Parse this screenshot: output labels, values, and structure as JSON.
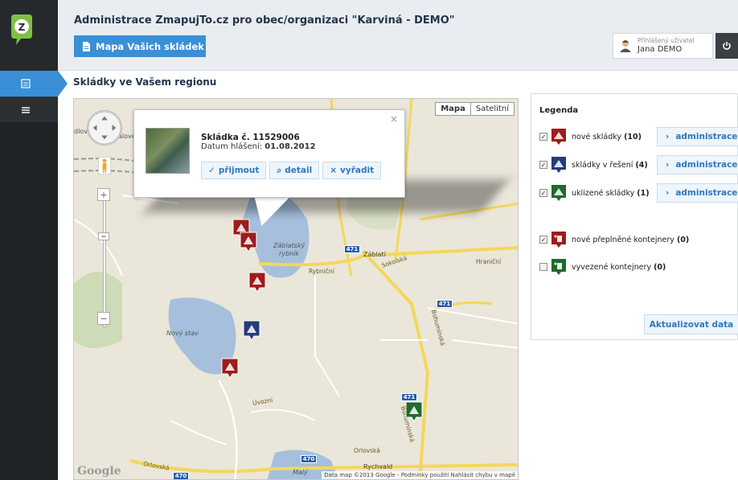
{
  "app": {
    "title": "Administrace ZmapujTo.cz pro obec/organizaci \"Karviná - DEMO\"",
    "tab_label": "Mapa Vašich skládek",
    "user_label": "Přihlášený uživatel",
    "user_name": "Jana DEMO"
  },
  "page": {
    "title": "Skládky ve Vašem regionu"
  },
  "map": {
    "type_map": "Mapa",
    "type_sat": "Satelitní",
    "labels": {
      "zablatsky": "Záblatský",
      "rybnik": "rybník",
      "zablati": "Záblatí",
      "novy_stav": "Nový stav",
      "rychvald": "Rychvald",
      "orlovska": "Orlovská",
      "orlovska2": "Orlovská",
      "hranicni": "Hraniční",
      "sokolska": "Sokolská",
      "rybnicni": "Rybniční",
      "bohuminska": "Bohumínská",
      "bohuminska2": "Bohumínská",
      "uvozni": "Úvozní",
      "malyy": "Malý",
      "dlov": "dlov",
      "alove": "álove"
    },
    "shields": {
      "s1": "471",
      "s2": "471",
      "s3": "471",
      "s4": "470",
      "s5": "470"
    },
    "google": "Google",
    "attribution": "Data map ©2013 Google - Podmínky použití  Nahlásit chybu v mapě"
  },
  "popup": {
    "title": "Skládka č. 11529006",
    "date_label": "Datum hlášení:",
    "date_value": "01.08.2012",
    "btn_accept": "přijmout",
    "btn_detail": "detail",
    "btn_discard": "vyřadit",
    "close": "×"
  },
  "legend": {
    "title": "Legenda",
    "rows": [
      {
        "label": "nové skládky",
        "count": "(10)",
        "color": "#9e1c1c",
        "checked": true,
        "button": "administrace"
      },
      {
        "label": "skládky v řešení",
        "count": "(4)",
        "color": "#243c7a",
        "checked": true,
        "button": "administrace"
      },
      {
        "label": "uklizené skládky",
        "count": "(1)",
        "color": "#1f6b2a",
        "checked": true,
        "button": "administrace"
      },
      {
        "label": "nové přeplněné kontejnery",
        "count": "(0)",
        "color": "#9e1c1c",
        "checked": true
      },
      {
        "label": "vyvezené kontejnery",
        "count": "(0)",
        "color": "#1f6b2a",
        "checked": false
      }
    ],
    "update_button": "Aktualizovat data"
  },
  "colors": {
    "accent": "#3a8fd6",
    "rail": "#1f2326",
    "header_bg": "#e9edf1",
    "water": "#a5bfdd",
    "marker_new": "#9e1c1c",
    "marker_progress": "#243c7a",
    "marker_done": "#1f6b2a"
  }
}
